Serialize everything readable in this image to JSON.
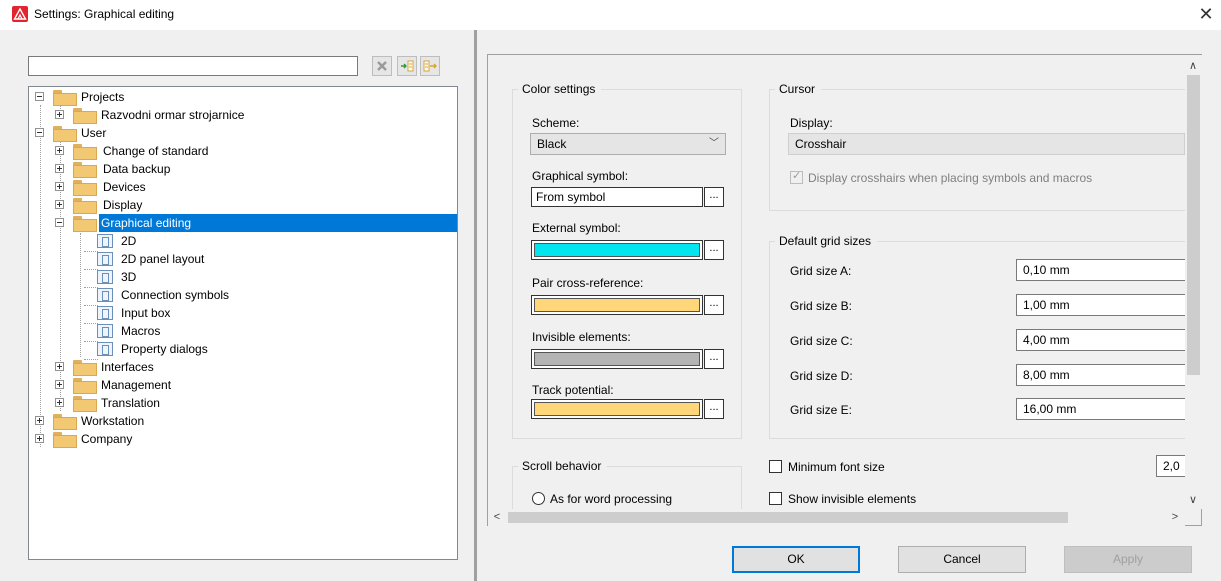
{
  "window": {
    "title": "Settings: Graphical editing",
    "close_glyph": "✕"
  },
  "search": {
    "value": "",
    "placeholder": ""
  },
  "toolbar": {
    "clear_icon": "clear-search-icon",
    "expand_icon": "expand-all-icon",
    "collapse_icon": "collapse-all-icon"
  },
  "tree": {
    "projects": "Projects",
    "razvodni": "Razvodni ormar strojarnice",
    "user": "User",
    "change_of_standard": "Change of standard",
    "data_backup": "Data backup",
    "devices": "Devices",
    "display": "Display",
    "graphical_editing": "Graphical editing",
    "ge_2d": "2D",
    "ge_2d_panel": "2D panel layout",
    "ge_3d": "3D",
    "ge_connection": "Connection symbols",
    "ge_input": "Input box",
    "ge_macros": "Macros",
    "ge_property": "Property dialogs",
    "interfaces": "Interfaces",
    "management": "Management",
    "translation": "Translation",
    "workstation": "Workstation",
    "company": "Company"
  },
  "color_settings": {
    "title": "Color settings",
    "scheme_label": "Scheme:",
    "scheme_value": "Black",
    "graphical_symbol_label": "Graphical symbol:",
    "graphical_symbol_value": "From symbol",
    "external_symbol_label": "External symbol:",
    "external_symbol_color": "#00e5ee",
    "pair_cross_label": "Pair cross-reference:",
    "pair_cross_color": "#ffd77a",
    "invisible_label": "Invisible elements:",
    "invisible_color": "#b4b4b4",
    "track_label": "Track potential:",
    "track_color": "#ffd77a",
    "dots": "..."
  },
  "cursor": {
    "title": "Cursor",
    "display_label": "Display:",
    "display_value": "Crosshair",
    "crosshair_checkbox_label": "Display crosshairs when placing symbols and macros"
  },
  "grid": {
    "title": "Default grid sizes",
    "rows": [
      {
        "label": "Grid size A:",
        "value": "0,10 mm"
      },
      {
        "label": "Grid size B:",
        "value": "1,00 mm"
      },
      {
        "label": "Grid size C:",
        "value": "4,00 mm"
      },
      {
        "label": "Grid size D:",
        "value": "8,00 mm"
      },
      {
        "label": "Grid size E:",
        "value": "16,00 mm"
      }
    ]
  },
  "scroll": {
    "title": "Scroll behavior",
    "option1": "As for word processing"
  },
  "min_font": {
    "label": "Minimum font size",
    "value": "2,0"
  },
  "show_invisible": {
    "label": "Show invisible elements"
  },
  "buttons": {
    "ok": "OK",
    "cancel": "Cancel",
    "apply": "Apply"
  },
  "colors": {
    "accent": "#0078d7",
    "app_icon": "#e3232d",
    "folder": "#f3c873"
  }
}
